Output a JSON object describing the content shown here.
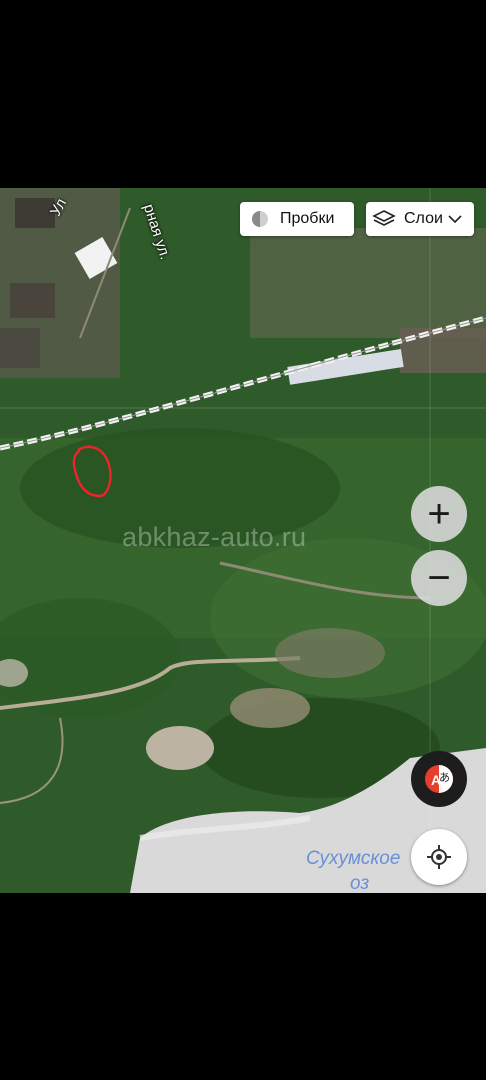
{
  "map": {
    "controls": {
      "traffic_label": "Пробки",
      "layers_label": "Слои",
      "zoom_in": "+",
      "zoom_out": "−"
    },
    "streets": [
      "Ул",
      "рная ул."
    ],
    "water_label": {
      "line1": "Сухумское",
      "line2": "оз"
    },
    "watermark": "abkhaz-auto.ru"
  },
  "colors": {
    "marker_circle": "#e8262b",
    "vegetation": "#2f5a2a",
    "water": "#d8d8d8",
    "railway": "#f0f0f0"
  }
}
